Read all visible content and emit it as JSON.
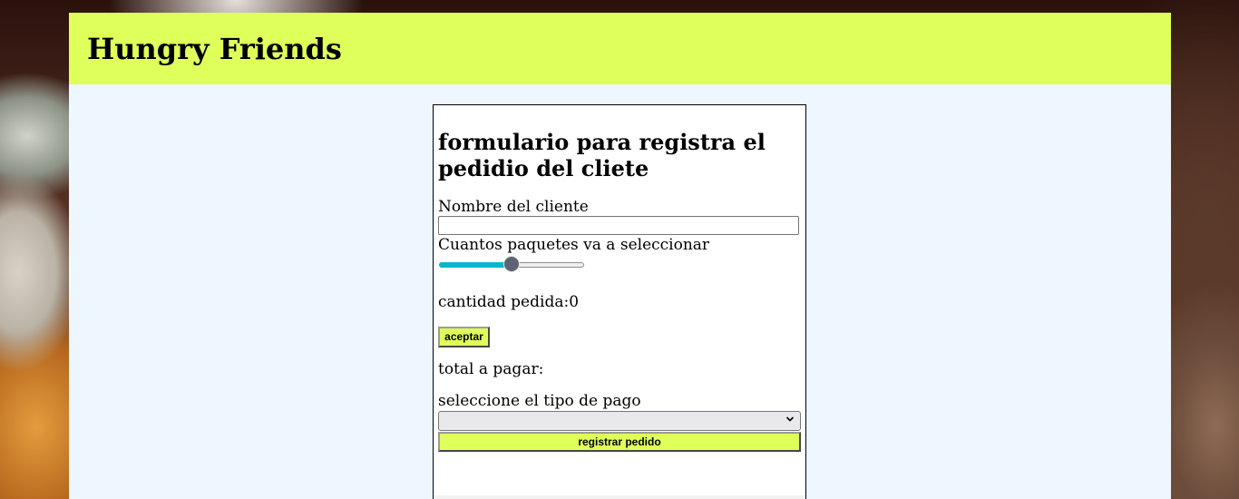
{
  "header": {
    "title": "Hungry Friends"
  },
  "form": {
    "title": "formulario para registra el pedidio del cliete",
    "name_label": "Nombre del cliente",
    "name_value": "",
    "packages_label": "Cuantos paquetes va a seleccionar",
    "slider_fraction": 0.5,
    "quantity_label": "cantidad pedida:",
    "quantity_value": "0",
    "accept_label": "aceptar",
    "total_label": "total a pagar:",
    "total_value": "",
    "payment_label": "seleccione el tipo de pago",
    "payment_selected": "",
    "register_label": "registrar pedido"
  },
  "colors": {
    "header_bg": "#dfff5a",
    "content_bg": "#eef6ff",
    "button_bg": "#dfff5a",
    "slider_fill": "#0bb5d0",
    "slider_thumb": "#5f6270"
  },
  "icons": {
    "select_arrow": "chevron-down-icon"
  }
}
